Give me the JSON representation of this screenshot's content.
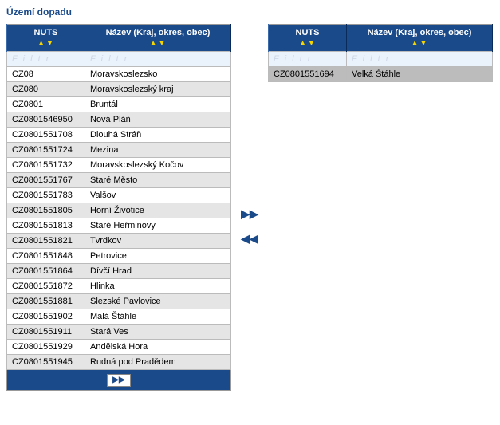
{
  "title": "Území dopadu",
  "headers": {
    "nuts": "NUTS",
    "name": "Název (Kraj, okres, obec)"
  },
  "filter_label": "F i l t r",
  "sort_asc": "▲",
  "sort_desc": "▼",
  "pager_next": "▶▶",
  "transfer": {
    "add": "▶▶",
    "remove": "◀◀"
  },
  "left_rows": [
    {
      "nuts": "CZ08",
      "name": "Moravskoslezsko"
    },
    {
      "nuts": "CZ080",
      "name": "Moravskoslezský kraj"
    },
    {
      "nuts": "CZ0801",
      "name": "Bruntál"
    },
    {
      "nuts": "CZ0801546950",
      "name": "Nová Pláň"
    },
    {
      "nuts": "CZ0801551708",
      "name": "Dlouhá Stráň"
    },
    {
      "nuts": "CZ0801551724",
      "name": "Mezina"
    },
    {
      "nuts": "CZ0801551732",
      "name": "Moravskoslezský Kočov"
    },
    {
      "nuts": "CZ0801551767",
      "name": "Staré Město"
    },
    {
      "nuts": "CZ0801551783",
      "name": "Valšov"
    },
    {
      "nuts": "CZ0801551805",
      "name": "Horní Životice"
    },
    {
      "nuts": "CZ0801551813",
      "name": "Staré Heřminovy"
    },
    {
      "nuts": "CZ0801551821",
      "name": "Tvrdkov"
    },
    {
      "nuts": "CZ0801551848",
      "name": "Petrovice"
    },
    {
      "nuts": "CZ0801551864",
      "name": "Dívčí Hrad"
    },
    {
      "nuts": "CZ0801551872",
      "name": "Hlinka"
    },
    {
      "nuts": "CZ0801551881",
      "name": "Slezské Pavlovice"
    },
    {
      "nuts": "CZ0801551902",
      "name": "Malá Štáhle"
    },
    {
      "nuts": "CZ0801551911",
      "name": "Stará Ves"
    },
    {
      "nuts": "CZ0801551929",
      "name": "Andělská Hora"
    },
    {
      "nuts": "CZ0801551945",
      "name": "Rudná pod Pradědem"
    }
  ],
  "right_rows": [
    {
      "nuts": "CZ0801551694",
      "name": "Velká Štáhle",
      "selected": true
    }
  ]
}
